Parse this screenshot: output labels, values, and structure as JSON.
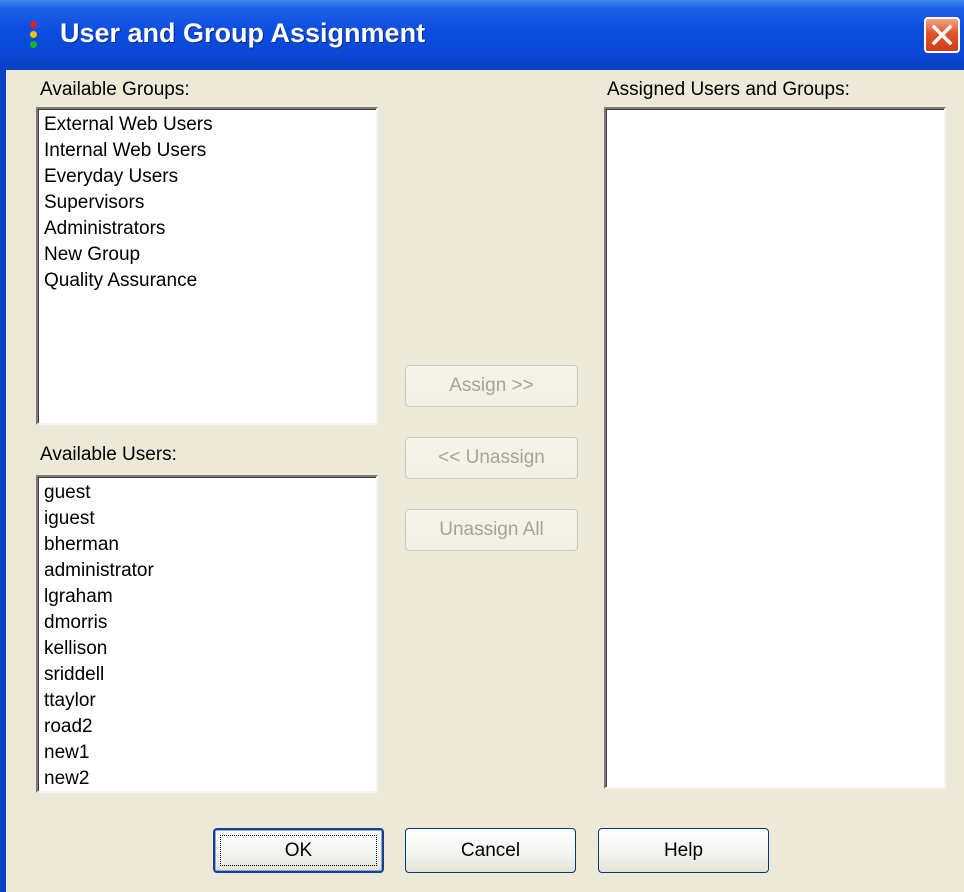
{
  "window": {
    "title": "User and Group Assignment"
  },
  "groups": {
    "label": "Available Groups:",
    "items": [
      "External Web Users",
      "Internal Web Users",
      "Everyday Users",
      "Supervisors",
      "Administrators",
      "New Group",
      "Quality Assurance"
    ]
  },
  "users": {
    "label": "Available Users:",
    "items": [
      "guest",
      "iguest",
      "bherman",
      "administrator",
      "lgraham",
      "dmorris",
      "kellison",
      "sriddell",
      "ttaylor",
      "road2",
      "new1",
      "new2"
    ]
  },
  "assigned": {
    "label": "Assigned Users and Groups:",
    "items": []
  },
  "actions": {
    "assign": "Assign >>",
    "unassign": "<< Unassign",
    "unassign_all": "Unassign All"
  },
  "footer": {
    "ok": "OK",
    "cancel": "Cancel",
    "help": "Help"
  },
  "colors": {
    "titlebar": "#0b4de0",
    "dialog_bg": "#ece9d8",
    "close_red": "#e0542c"
  },
  "icons": {
    "app": "traffic-light-icon",
    "close": "close-icon"
  }
}
